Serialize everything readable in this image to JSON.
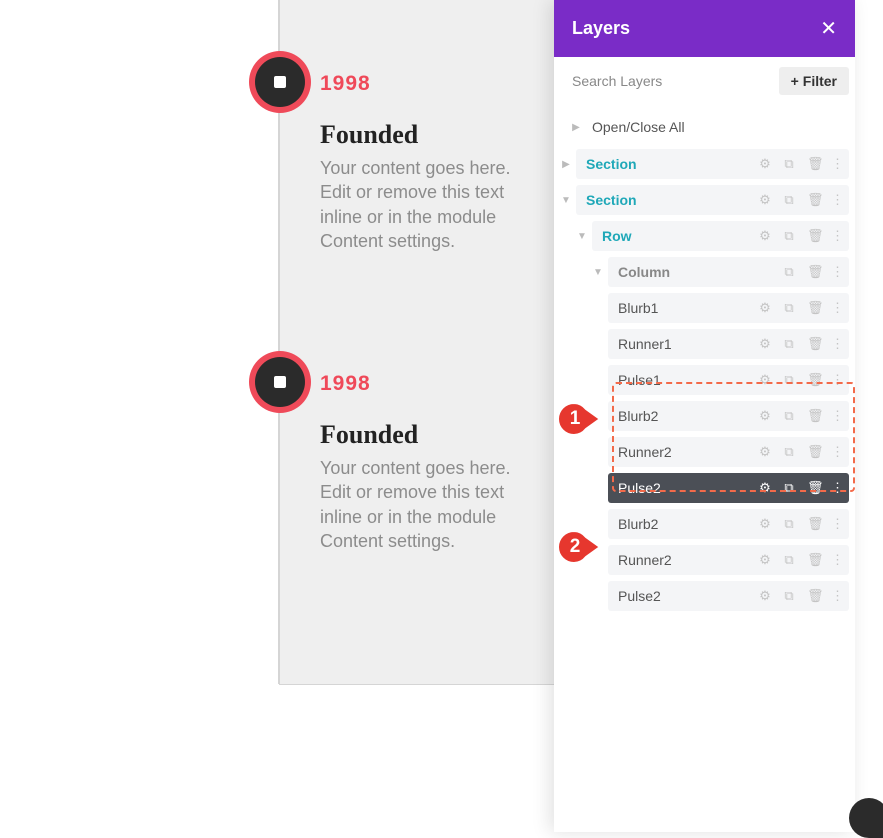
{
  "content": {
    "entries": [
      {
        "year": "1998",
        "heading": "Founded",
        "body": "Your content goes here. Edit or remove this text inline or in the module Content settings."
      },
      {
        "year": "1998",
        "heading": "Founded",
        "body": "Your content goes here. Edit or remove this text inline or in the module Content settings."
      }
    ]
  },
  "panel": {
    "title": "Layers",
    "search_placeholder": "Search Layers",
    "filter_label": "Filter",
    "open_close": "Open/Close All",
    "tree": {
      "section1": "Section",
      "section2": "Section",
      "row": "Row",
      "column": "Column",
      "items": [
        {
          "label": "Blurb1"
        },
        {
          "label": "Runner1"
        },
        {
          "label": "Pulse1"
        },
        {
          "label": "Blurb2"
        },
        {
          "label": "Runner2"
        },
        {
          "label": "Pulse2"
        },
        {
          "label": "Blurb2"
        },
        {
          "label": "Runner2"
        },
        {
          "label": "Pulse2"
        }
      ]
    },
    "callouts": {
      "c1": "1",
      "c2": "2"
    }
  }
}
